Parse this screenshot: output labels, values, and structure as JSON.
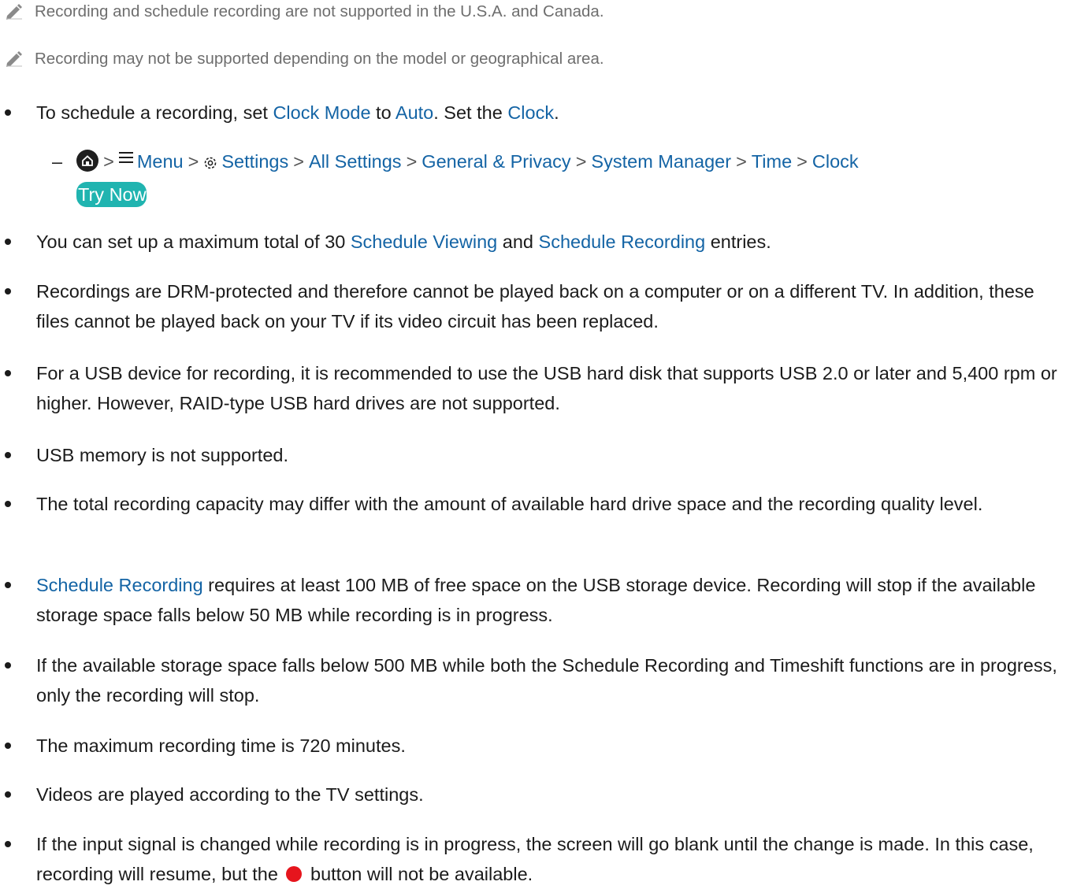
{
  "notes": [
    "Recording and schedule recording are not supported in the U.S.A. and Canada.",
    "Recording may not be supported depending on the model or geographical area."
  ],
  "b1": {
    "t1": "To schedule a recording, set ",
    "l1": "Clock Mode",
    "t2": " to ",
    "l2": "Auto",
    "t3": ". Set the ",
    "l3": "Clock",
    "t4": "."
  },
  "path": {
    "dash": "–",
    "sep": ">",
    "items": [
      "Menu",
      "Settings",
      "All Settings",
      "General & Privacy",
      "System Manager",
      "Time",
      "Clock"
    ],
    "try_now": "Try Now"
  },
  "b2": {
    "t1": "You can set up a maximum total of 30 ",
    "l1": "Schedule Viewing",
    "t2": " and ",
    "l2": "Schedule Recording",
    "t3": " entries."
  },
  "b3": "Recordings are DRM-protected and therefore cannot be played back on a computer or on a different TV. In addition, these files cannot be played back on your TV if its video circuit has been replaced.",
  "b4": "For a USB device for recording, it is recommended to use the USB hard disk that supports USB 2.0 or later and 5,400 rpm or higher. However, RAID-type USB hard drives are not supported.",
  "b5": "USB memory is not supported.",
  "b6": "The total recording capacity may differ with the amount of available hard drive space and the recording quality level.",
  "b7": {
    "l1": "Schedule Recording",
    "t1": " requires at least 100 MB of free space on the USB storage device. Recording will stop if the available storage space falls below 50 MB while recording is in progress."
  },
  "b8": "If the available storage space falls below 500 MB while both the Schedule Recording and Timeshift functions are in progress, only the recording will stop.",
  "b9": "The maximum recording time is 720 minutes.",
  "b10": "Videos are played according to the TV settings.",
  "b11": {
    "t1": "If the input signal is changed while recording is in progress, the screen will go blank until the change is made. In this case, recording will resume, but the ",
    "t2": " button will not be available."
  },
  "colors": {
    "link": "#1464a5",
    "try_now_bg": "#20b4b0",
    "record_dot": "#e6151d"
  }
}
